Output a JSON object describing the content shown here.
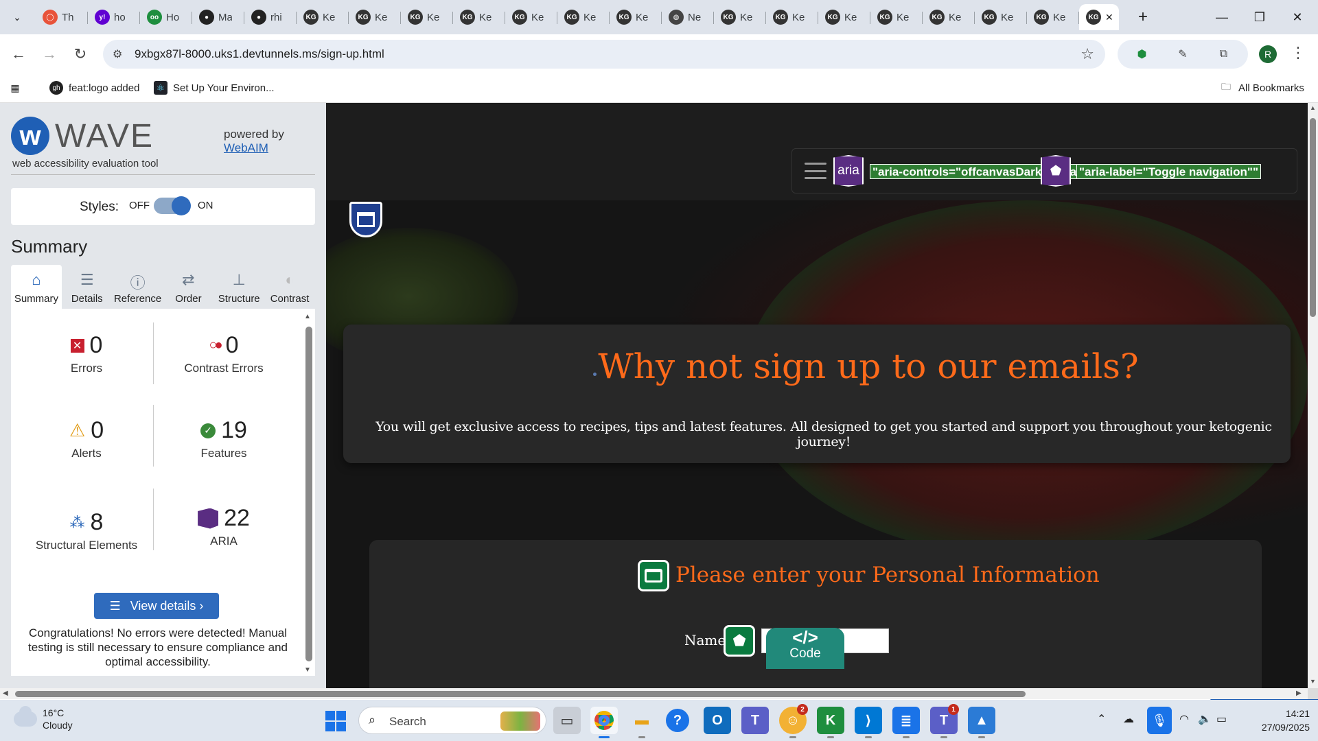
{
  "browser": {
    "tabs": [
      {
        "label": "Th",
        "favicon": "circle-o",
        "color": "#e8533a"
      },
      {
        "label": "ho",
        "favicon": "y!",
        "color": "#6001d2"
      },
      {
        "label": "Ho",
        "favicon": "oo",
        "color": "#1e8e3e"
      },
      {
        "label": "Ma",
        "favicon": "gh",
        "color": "#222222"
      },
      {
        "label": "rhi",
        "favicon": "gh",
        "color": "#222222"
      },
      {
        "label": "Ke",
        "favicon": "KG",
        "color": "#333333"
      },
      {
        "label": "Ke",
        "favicon": "KG",
        "color": "#333333"
      },
      {
        "label": "Ke",
        "favicon": "KG",
        "color": "#333333"
      },
      {
        "label": "Ke",
        "favicon": "KG",
        "color": "#333333"
      },
      {
        "label": "Ke",
        "favicon": "KG",
        "color": "#333333"
      },
      {
        "label": "Ke",
        "favicon": "KG",
        "color": "#333333"
      },
      {
        "label": "Ke",
        "favicon": "KG",
        "color": "#333333"
      },
      {
        "label": "Ne",
        "favicon": "globe",
        "color": "#444444"
      },
      {
        "label": "Ke",
        "favicon": "KG",
        "color": "#333333"
      },
      {
        "label": "Ke",
        "favicon": "KG",
        "color": "#333333"
      },
      {
        "label": "Ke",
        "favicon": "KG",
        "color": "#333333"
      },
      {
        "label": "Ke",
        "favicon": "KG",
        "color": "#333333"
      },
      {
        "label": "Ke",
        "favicon": "KG",
        "color": "#333333"
      },
      {
        "label": "Ke",
        "favicon": "KG",
        "color": "#333333"
      },
      {
        "label": "Ke",
        "favicon": "KG",
        "color": "#333333"
      }
    ],
    "active_tab": {
      "favicon": "KG"
    },
    "url": "9xbgx87l-8000.uks1.devtunnels.ms/sign-up.html",
    "profile_initial": "R",
    "bookmarks": [
      {
        "label": "feat:logo added",
        "icon": "github-icon"
      },
      {
        "label": "Set Up Your Environ...",
        "icon": "react-icon"
      }
    ],
    "all_bookmarks": "All Bookmarks"
  },
  "wave": {
    "logo_text": "WAVE",
    "tagline": "web accessibility evaluation tool",
    "powered_by": "powered by",
    "webaim_link": "WebAIM",
    "styles_label": "Styles:",
    "off_label": "OFF",
    "on_label": "ON",
    "styles_on": true,
    "summary_heading": "Summary",
    "tabs": [
      {
        "label": "Summary",
        "icon": "home-icon",
        "glyph": "⌂"
      },
      {
        "label": "Details",
        "icon": "list-icon",
        "glyph": "☰"
      },
      {
        "label": "Reference",
        "icon": "info-icon",
        "glyph": "ⓘ"
      },
      {
        "label": "Order",
        "icon": "order-icon",
        "glyph": "⇄"
      },
      {
        "label": "Structure",
        "icon": "structure-icon",
        "glyph": "⊥"
      },
      {
        "label": "Contrast",
        "icon": "contrast-icon",
        "glyph": "◐"
      }
    ],
    "stats": {
      "errors": {
        "value": "0",
        "label": "Errors"
      },
      "contrast_errors": {
        "value": "0",
        "label": "Contrast Errors"
      },
      "alerts": {
        "value": "0",
        "label": "Alerts"
      },
      "features": {
        "value": "19",
        "label": "Features"
      },
      "structural": {
        "value": "8",
        "label": "Structural Elements"
      },
      "aria": {
        "value": "22",
        "label": "ARIA"
      }
    },
    "view_details": "View details ›",
    "congrats": "Congratulations! No errors were detected! Manual testing is still necessary to ensure compliance and optimal accessibility."
  },
  "page": {
    "aria_icon_label": "aria",
    "aria_controls": "\"aria-controls=\"offcanvasDarkNavbar\"\"",
    "aria_label": "\"aria-label=\"Toggle navigation\"\"",
    "hero_title": "Why not sign up to our emails?",
    "hero_subtitle": "You will get exclusive access to recipes, tips and latest features. All designed to get you started and support you throughout your ketogenic journey!",
    "form_title": "Please enter your Personal Information",
    "name_label": "Name:",
    "name_value": "",
    "code_badge_glyph": "</>",
    "code_badge_label": "Code"
  },
  "taskbar": {
    "temperature": "16°C",
    "condition": "Cloudy",
    "search_label": "Search",
    "time": "14:21",
    "date": "27/09/2025",
    "badges": {
      "copilot": "2",
      "teams": "1"
    }
  },
  "colors": {
    "accent_orange": "#ff6a1a",
    "wave_blue": "#1f5fb5",
    "aria_purple": "#5a2d82",
    "feature_green": "#0a7a3f"
  }
}
